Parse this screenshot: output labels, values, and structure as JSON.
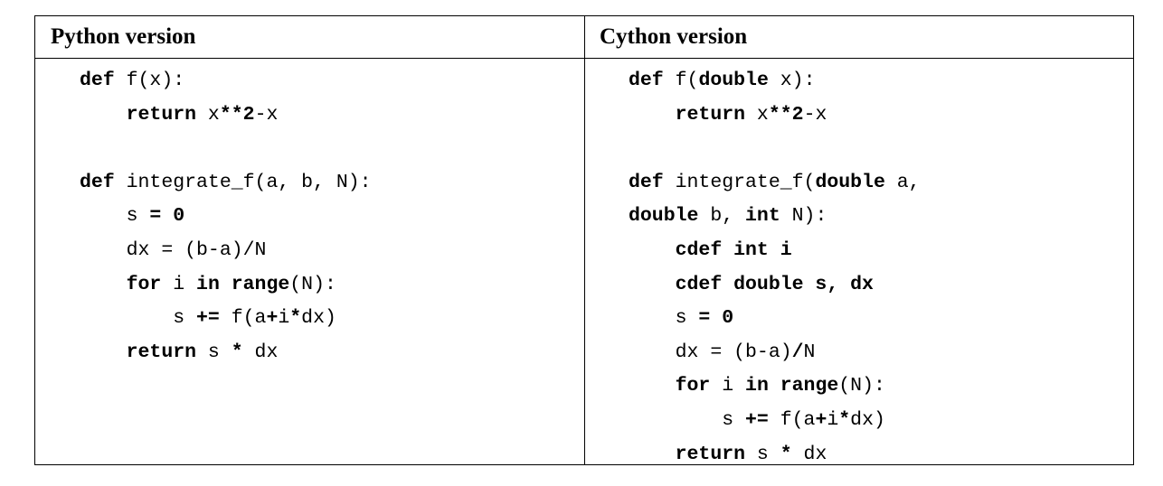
{
  "table": {
    "headers": [
      "Python version",
      "Cython version"
    ]
  },
  "python_code": [
    [
      {
        "t": "def",
        "b": true
      },
      {
        "t": " f(x):"
      }
    ],
    [
      {
        "t": "    "
      },
      {
        "t": "return",
        "b": true
      },
      {
        "t": " x"
      },
      {
        "t": "**2",
        "b": true
      },
      {
        "t": "-x"
      }
    ],
    [],
    [
      {
        "t": "def",
        "b": true
      },
      {
        "t": " integrate_f(a, b, N):"
      }
    ],
    [
      {
        "t": "    s "
      },
      {
        "t": "= 0",
        "b": true
      }
    ],
    [
      {
        "t": "    dx = (b-a)/N"
      }
    ],
    [
      {
        "t": "    "
      },
      {
        "t": "for",
        "b": true
      },
      {
        "t": " i "
      },
      {
        "t": "in range",
        "b": true
      },
      {
        "t": "(N):"
      }
    ],
    [
      {
        "t": "        s "
      },
      {
        "t": "+=",
        "b": true
      },
      {
        "t": " f(a"
      },
      {
        "t": "+",
        "b": true
      },
      {
        "t": "i"
      },
      {
        "t": "*",
        "b": true
      },
      {
        "t": "dx)"
      }
    ],
    [
      {
        "t": "    "
      },
      {
        "t": "return",
        "b": true
      },
      {
        "t": " s "
      },
      {
        "t": "*",
        "b": true
      },
      {
        "t": " dx"
      }
    ]
  ],
  "cython_code": [
    [
      {
        "t": "def",
        "b": true
      },
      {
        "t": " f("
      },
      {
        "t": "double",
        "b": true
      },
      {
        "t": " x):"
      }
    ],
    [
      {
        "t": "    "
      },
      {
        "t": "return",
        "b": true
      },
      {
        "t": " x"
      },
      {
        "t": "**2",
        "b": true
      },
      {
        "t": "-x"
      }
    ],
    [],
    [
      {
        "t": "def",
        "b": true
      },
      {
        "t": " integrate_f("
      },
      {
        "t": "double",
        "b": true
      },
      {
        "t": " a,"
      }
    ],
    [
      {
        "t": "double",
        "b": true
      },
      {
        "t": " b, "
      },
      {
        "t": "int",
        "b": true
      },
      {
        "t": " N):"
      }
    ],
    [
      {
        "t": "    "
      },
      {
        "t": "cdef int i",
        "b": true
      }
    ],
    [
      {
        "t": "    "
      },
      {
        "t": "cdef double s, dx",
        "b": true
      }
    ],
    [
      {
        "t": "    s "
      },
      {
        "t": "= 0",
        "b": true
      }
    ],
    [
      {
        "t": "    dx = (b-a)"
      },
      {
        "t": "/",
        "b": true
      },
      {
        "t": "N"
      }
    ],
    [
      {
        "t": "    "
      },
      {
        "t": "for",
        "b": true
      },
      {
        "t": " i "
      },
      {
        "t": "in range",
        "b": true
      },
      {
        "t": "(N):"
      }
    ],
    [
      {
        "t": "        s "
      },
      {
        "t": "+=",
        "b": true
      },
      {
        "t": " f(a"
      },
      {
        "t": "+",
        "b": true
      },
      {
        "t": "i"
      },
      {
        "t": "*",
        "b": true
      },
      {
        "t": "dx)"
      }
    ],
    [
      {
        "t": "    "
      },
      {
        "t": "return",
        "b": true
      },
      {
        "t": " s "
      },
      {
        "t": "*",
        "b": true
      },
      {
        "t": " dx"
      }
    ]
  ]
}
